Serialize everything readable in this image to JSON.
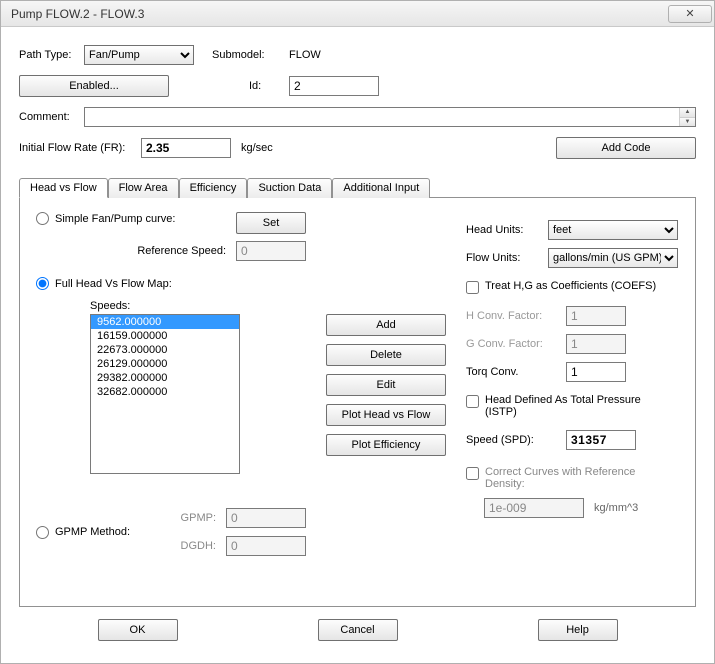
{
  "window": {
    "title": "Pump FLOW.2 - FLOW.3"
  },
  "pathType": {
    "label": "Path Type:",
    "value": "Fan/Pump",
    "options": [
      "Fan/Pump"
    ]
  },
  "submodel": {
    "label": "Submodel:",
    "value": "FLOW"
  },
  "enabled": {
    "label": "Enabled..."
  },
  "id": {
    "label": "Id:",
    "value": "2"
  },
  "comment": {
    "label": "Comment:",
    "value": ""
  },
  "initialFlow": {
    "label": "Initial Flow Rate (FR):",
    "value": "2.35",
    "unit": "kg/sec"
  },
  "addCode": {
    "label": "Add Code"
  },
  "tabs": [
    "Head vs Flow",
    "Flow Area",
    "Efficiency",
    "Suction Data",
    "Additional Input"
  ],
  "activeTab": 0,
  "simpleCurve": {
    "label": "Simple Fan/Pump curve:",
    "checked": false
  },
  "setBtn": "Set",
  "refSpeed": {
    "label": "Reference Speed:",
    "value": "0"
  },
  "fullMap": {
    "label": "Full Head Vs Flow Map:",
    "checked": true
  },
  "speedsLabel": "Speeds:",
  "speeds": [
    "9562.000000",
    "16159.000000",
    "22673.000000",
    "26129.000000",
    "29382.000000",
    "32682.000000"
  ],
  "speedSelectedIndex": 0,
  "midButtons": {
    "add": "Add",
    "delete": "Delete",
    "edit": "Edit",
    "plotHF": "Plot  Head vs Flow",
    "plotEff": "Plot Efficiency"
  },
  "gpmpMethod": {
    "label": "GPMP Method:",
    "checked": false
  },
  "gpmp": {
    "label": "GPMP:",
    "value": "0"
  },
  "dgdh": {
    "label": "DGDH:",
    "value": "0"
  },
  "headUnits": {
    "label": "Head Units:",
    "value": "feet",
    "options": [
      "feet"
    ]
  },
  "flowUnits": {
    "label": "Flow Units:",
    "value": "gallons/min (US GPM)",
    "options": [
      "gallons/min (US GPM)"
    ]
  },
  "treatCoefs": {
    "label": "Treat H,G as Coefficients (COEFS)",
    "checked": false
  },
  "hConv": {
    "label": "H Conv. Factor:",
    "value": "1"
  },
  "gConv": {
    "label": "G Conv. Factor:",
    "value": "1"
  },
  "torqConv": {
    "label": "Torq Conv.",
    "value": "1"
  },
  "headTotal": {
    "label": "Head Defined As Total Pressure (ISTP)",
    "checked": false
  },
  "speedSpd": {
    "label": "Speed (SPD):",
    "value": "31357"
  },
  "correctDens": {
    "label": "Correct Curves with Reference Density:",
    "checked": false,
    "value": "1e-009",
    "unit": "kg/mm^3"
  },
  "bottom": {
    "ok": "OK",
    "cancel": "Cancel",
    "help": "Help"
  }
}
